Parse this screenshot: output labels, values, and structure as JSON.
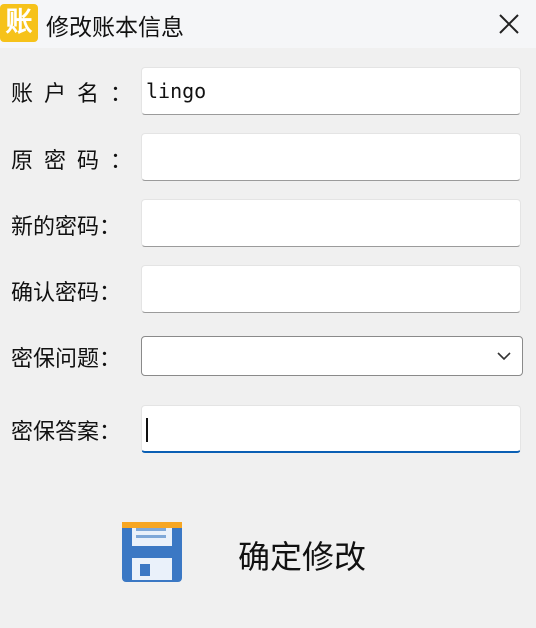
{
  "window": {
    "title": "修改账本信息",
    "app_icon_char": "账",
    "app_icon_color": "#f6c21a",
    "close_icon": "close-icon"
  },
  "form": {
    "account_name": {
      "label": "账户名：",
      "value": "lingo"
    },
    "old_password": {
      "label": "原密码：",
      "value": ""
    },
    "new_password": {
      "label": "新的密码：",
      "value": ""
    },
    "confirm_password": {
      "label": "确认密码：",
      "value": ""
    },
    "security_question": {
      "label": "密保问题：",
      "value": "",
      "icon": "chevron-down-icon"
    },
    "security_answer": {
      "label": "密保答案：",
      "value": ""
    }
  },
  "actions": {
    "confirm_label": "确定修改",
    "confirm_icon": "floppy-disk-icon",
    "accent_color": "#0a5fb4"
  }
}
